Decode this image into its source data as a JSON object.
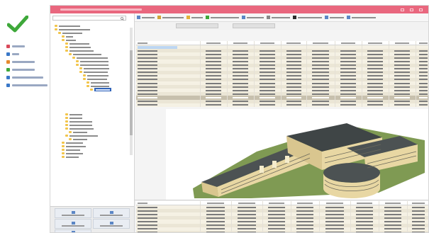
{
  "colors": {
    "checkmark": "#3ea83a",
    "titlebar": "#e9677e",
    "selection": "#2f63b8",
    "table_row_light": "#f5f1e4",
    "table_row_dark": "#ebe6d6",
    "table_total_row": "#c7c0ad",
    "ground": "#7f9a53",
    "roof": "#4c5253",
    "wall": "#e8d7a3"
  },
  "icons": {
    "checkmark": "checkmark-icon",
    "folder": "folder-icon",
    "tree_toggle": "tree-toggle-icon",
    "minimize": "minimize-icon",
    "maximize": "maximize-icon",
    "close": "close-icon",
    "search": "search-icon"
  },
  "nav": {
    "items": [
      {
        "label": ""
      },
      {
        "label": ""
      },
      {
        "label": ""
      },
      {
        "label": ""
      },
      {
        "label": ""
      },
      {
        "label": ""
      }
    ]
  },
  "window": {
    "title": ""
  },
  "toolbar": {
    "items": [
      {
        "label": ""
      },
      {
        "label": ""
      },
      {
        "label": ""
      },
      {
        "label": ""
      },
      {
        "label": ""
      },
      {
        "label": ""
      },
      {
        "label": ""
      },
      {
        "label": ""
      },
      {
        "label": ""
      },
      {
        "label": ""
      }
    ]
  },
  "subbar": {
    "buttons": [
      {
        "label": ""
      },
      {
        "label": ""
      }
    ]
  },
  "tree": {
    "search_placeholder": "",
    "rows": []
  },
  "upper_table": {
    "columns": [],
    "rows": []
  },
  "lower_table": {
    "columns": [],
    "rows": []
  },
  "panel": {
    "buttons": [
      {
        "label": ""
      },
      {
        "label": ""
      },
      {
        "label": ""
      },
      {
        "label": ""
      },
      {
        "label": ""
      }
    ]
  }
}
